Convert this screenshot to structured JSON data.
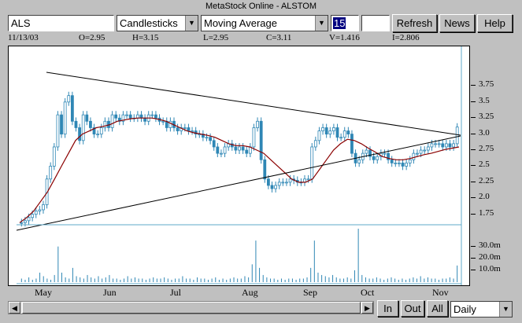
{
  "window": {
    "title": "MetaStock Online - ALSTOM"
  },
  "toolbar": {
    "symbol_value": "ALS",
    "chart_type": "Candlesticks",
    "indicator": "Moving Average",
    "period_value": "15",
    "extra_value": "",
    "refresh_label": "Refresh",
    "news_label": "News",
    "help_label": "Help"
  },
  "info_bar": {
    "date": "11/13/03",
    "open": "O=2.95",
    "high": "H=3.15",
    "low": "L=2.95",
    "close": "C=3.11",
    "volume": "V=1.416",
    "indicator": "I=2.806"
  },
  "bottom": {
    "in_label": "In",
    "out_label": "Out",
    "all_label": "All",
    "interval": "Daily"
  },
  "colors": {
    "candle": "#2f87b5",
    "ma": "#8b0000",
    "trend": "#000000",
    "panel_border": "#5fa8c8"
  },
  "chart_data": {
    "type": "candlestick",
    "indicator": "Moving Average (15)",
    "x_labels": [
      "May",
      "Jun",
      "Jul",
      "Aug",
      "Sep",
      "Oct",
      "Nov"
    ],
    "price_ticks": [
      "3.75",
      "3.5",
      "3.25",
      "3.0",
      "2.75",
      "2.5",
      "2.25",
      "2.0",
      "1.75"
    ],
    "price_ylim": [
      1.55,
      4.0
    ],
    "volume_ticks": [
      "30.0m",
      "20.0m",
      "10.0m"
    ],
    "volume_ylim": [
      0,
      45
    ],
    "close_approx": [
      1.62,
      1.65,
      1.7,
      1.75,
      1.8,
      1.82,
      1.9,
      2.3,
      2.5,
      2.8,
      3.3,
      3.0,
      3.5,
      3.6,
      3.2,
      3.1,
      2.9,
      3.3,
      3.2,
      3.1,
      3.0,
      3.0,
      3.1,
      3.2,
      3.1,
      3.3,
      3.25,
      3.2,
      3.3,
      3.3,
      3.25,
      3.25,
      3.3,
      3.25,
      3.2,
      3.3,
      3.3,
      3.25,
      3.2,
      3.2,
      3.1,
      3.2,
      3.1,
      3.05,
      3.1,
      3.1,
      3.05,
      3.05,
      3.0,
      3.0,
      2.95,
      2.95,
      2.9,
      2.8,
      2.7,
      2.7,
      2.8,
      2.85,
      2.8,
      2.75,
      2.8,
      2.75,
      2.7,
      2.8,
      3.1,
      3.2,
      2.6,
      2.3,
      2.2,
      2.15,
      2.2,
      2.25,
      2.25,
      2.25,
      2.3,
      2.28,
      2.25,
      2.25,
      2.3,
      2.3,
      2.8,
      2.9,
      3.05,
      3.1,
      3.0,
      3.05,
      3.1,
      2.95,
      2.95,
      3.05,
      3.0,
      2.7,
      2.55,
      2.6,
      2.7,
      2.75,
      2.65,
      2.6,
      2.65,
      2.7,
      2.7,
      2.6,
      2.55,
      2.55,
      2.55,
      2.5,
      2.55,
      2.6,
      2.7,
      2.7,
      2.75,
      2.75,
      2.8,
      2.85,
      2.85,
      2.85,
      2.8,
      2.85,
      2.8,
      2.85,
      3.11
    ],
    "ma_approx": [
      1.62,
      1.7,
      1.8,
      1.95,
      2.1,
      2.3,
      2.5,
      2.7,
      2.9,
      3.0,
      3.05,
      3.1,
      3.12,
      3.15,
      3.2,
      3.22,
      3.24,
      3.25,
      3.25,
      3.25,
      3.23,
      3.2,
      3.15,
      3.1,
      3.05,
      3.02,
      3.0,
      2.98,
      2.95,
      2.9,
      2.85,
      2.82,
      2.82,
      2.8,
      2.75,
      2.7,
      2.6,
      2.5,
      2.4,
      2.3,
      2.25,
      2.25,
      2.3,
      2.45,
      2.6,
      2.75,
      2.85,
      2.92,
      2.9,
      2.85,
      2.78,
      2.72,
      2.65,
      2.62,
      2.6,
      2.6,
      2.62,
      2.65,
      2.68,
      2.7,
      2.73,
      2.76,
      2.78,
      2.8
    ],
    "volume_approx": [
      3,
      2,
      4,
      2,
      3,
      8,
      5,
      3,
      2,
      6,
      30,
      8,
      4,
      3,
      12,
      5,
      4,
      3,
      6,
      4,
      3,
      5,
      3,
      4,
      6,
      3,
      3,
      2,
      3,
      5,
      3,
      4,
      3,
      3,
      2,
      3,
      4,
      3,
      3,
      4,
      3,
      2,
      3,
      3,
      5,
      3,
      3,
      2,
      4,
      3,
      3,
      2,
      3,
      4,
      2,
      3,
      2,
      3,
      4,
      3,
      3,
      5,
      4,
      15,
      35,
      12,
      6,
      4,
      3,
      3,
      2,
      3,
      2,
      3,
      3,
      2,
      3,
      3,
      4,
      12,
      35,
      8,
      6,
      5,
      4,
      6,
      4,
      3,
      3,
      4,
      3,
      10,
      45,
      6,
      4,
      3,
      3,
      4,
      3,
      2,
      3,
      4,
      3,
      2,
      3,
      2,
      3,
      4,
      3,
      5,
      3,
      4,
      3,
      3,
      2,
      3,
      3,
      4,
      3,
      14
    ]
  }
}
